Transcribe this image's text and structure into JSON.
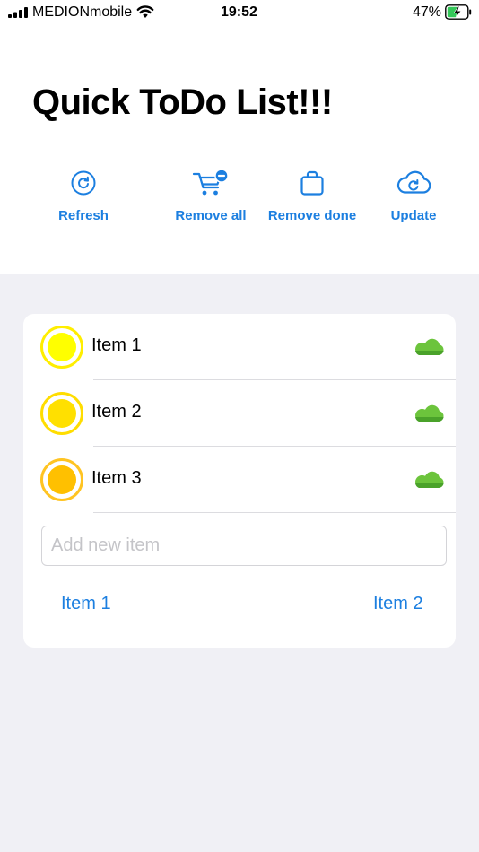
{
  "status_bar": {
    "carrier": "MEDIONmobile",
    "time": "19:52",
    "battery_percent": "47%"
  },
  "page_title": "Quick ToDo List!!!",
  "toolbar": {
    "refresh_label": "Refresh",
    "remove_all_label": "Remove all",
    "remove_done_label": "Remove done",
    "update_label": "Update"
  },
  "colors": {
    "accent": "#1c7fe0",
    "item1": "#ffff00",
    "item2": "#ffe000",
    "item3": "#ffc000",
    "cloud": "#6cc43c"
  },
  "items": [
    {
      "label": "Item 1",
      "icon": "cloud-icon"
    },
    {
      "label": "Item 2",
      "icon": "cloud-icon"
    },
    {
      "label": "Item 3",
      "icon": "cloud-icon"
    }
  ],
  "add_input": {
    "placeholder": "Add new item",
    "value": ""
  },
  "quick_links": [
    "Item 1",
    "Item 2"
  ]
}
